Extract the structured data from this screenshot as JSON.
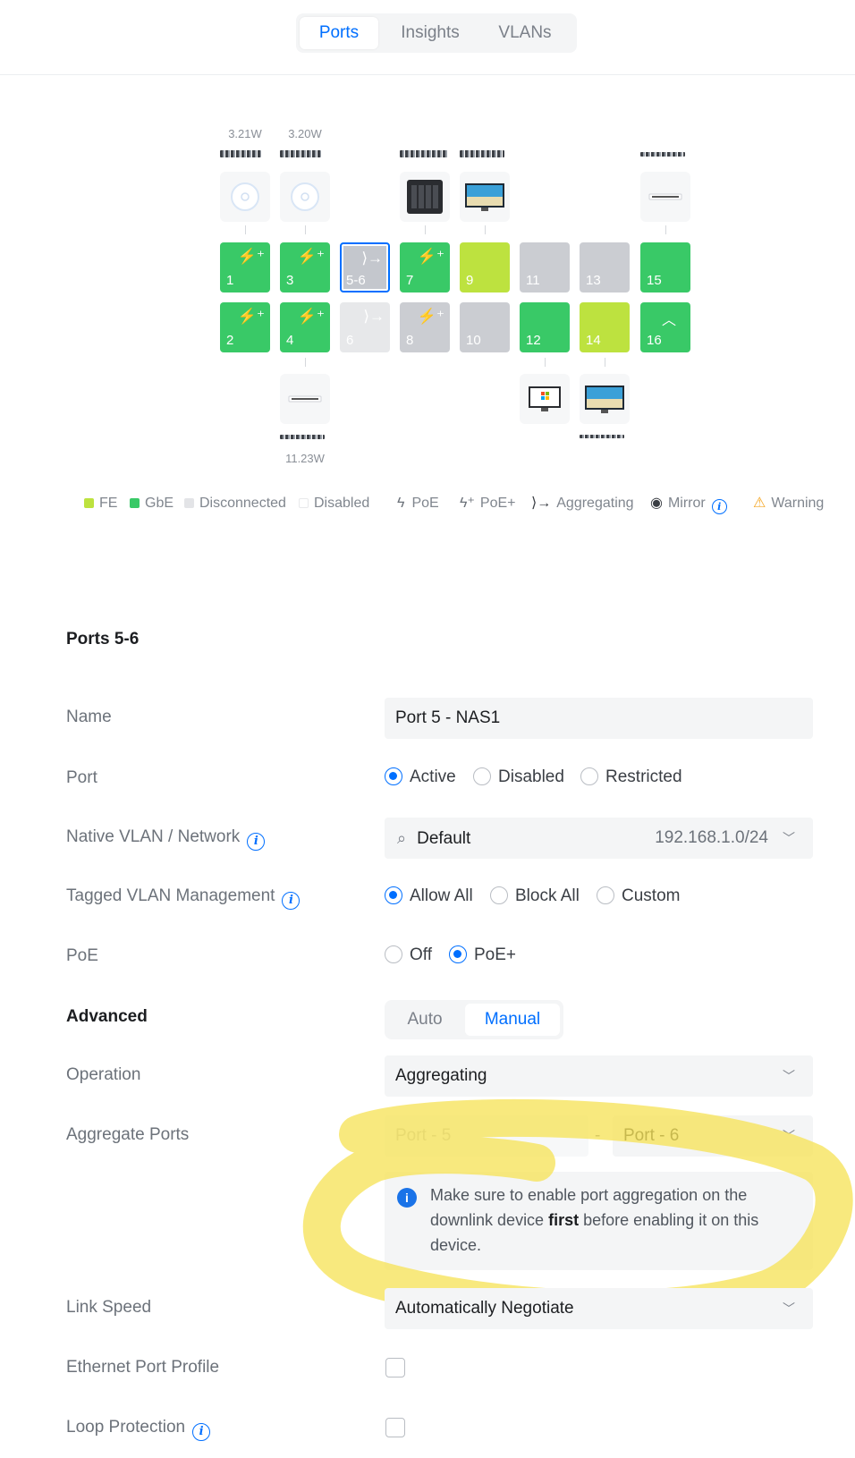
{
  "tabs": [
    "Ports",
    "Insights",
    "VLANs"
  ],
  "active_tab": "Ports",
  "switch": {
    "power_readings": [
      "3.21W",
      "3.20W",
      "11.23W"
    ],
    "ports": [
      {
        "num": "1",
        "state": "GbE",
        "icon": "PoE+"
      },
      {
        "num": "2",
        "state": "GbE",
        "icon": "PoE+"
      },
      {
        "num": "3",
        "state": "GbE",
        "icon": "PoE+"
      },
      {
        "num": "4",
        "state": "GbE",
        "icon": "PoE+"
      },
      {
        "num": "5-6",
        "state": "Disconnected",
        "icon": "Aggregating",
        "selected": true
      },
      {
        "num": "6",
        "state": "Disabled",
        "icon": "Aggregating"
      },
      {
        "num": "7",
        "state": "GbE",
        "icon": "PoE+"
      },
      {
        "num": "8",
        "state": "Disconnected",
        "icon": "PoE+"
      },
      {
        "num": "9",
        "state": "FE",
        "icon": ""
      },
      {
        "num": "10",
        "state": "Disconnected",
        "icon": ""
      },
      {
        "num": "11",
        "state": "Disconnected",
        "icon": ""
      },
      {
        "num": "12",
        "state": "GbE",
        "icon": ""
      },
      {
        "num": "13",
        "state": "Disconnected",
        "icon": ""
      },
      {
        "num": "14",
        "state": "FE",
        "icon": ""
      },
      {
        "num": "15",
        "state": "GbE",
        "icon": ""
      },
      {
        "num": "16",
        "state": "GbE",
        "icon": "uplink"
      }
    ],
    "devices": [
      "access-point-icon",
      "access-point-icon",
      "nas-icon",
      "monitor-icon",
      "switch-icon",
      "switch-icon",
      "windows-pc-icon",
      "monitor-icon"
    ]
  },
  "legend": {
    "fe": "FE",
    "gbe": "GbE",
    "disconnected": "Disconnected",
    "disabled": "Disabled",
    "poe": "PoE",
    "poe_plus": "PoE+",
    "aggregating": "Aggregating",
    "mirror": "Mirror",
    "warning": "Warning"
  },
  "colors": {
    "accent": "#006fff",
    "fe": "#bde23f",
    "gbe": "#39c967",
    "disconnected": "#cbcdd2",
    "disabled": "#e7e8ea",
    "highlight": "#f6e35a"
  },
  "form": {
    "title": "Ports 5-6",
    "name_label": "Name",
    "name_value": "Port 5 - NAS1",
    "port_label": "Port",
    "port_options": [
      "Active",
      "Disabled",
      "Restricted"
    ],
    "port_selected": "Active",
    "native_vlan_label": "Native VLAN / Network",
    "native_vlan_value": "Default",
    "native_vlan_subnet": "192.168.1.0/24",
    "tagged_label": "Tagged VLAN Management",
    "tagged_options": [
      "Allow All",
      "Block All",
      "Custom"
    ],
    "tagged_selected": "Allow All",
    "poe_label": "PoE",
    "poe_options": [
      "Off",
      "PoE+"
    ],
    "poe_selected": "PoE+",
    "advanced_label": "Advanced",
    "advanced_options": [
      "Auto",
      "Manual"
    ],
    "advanced_selected": "Manual",
    "operation_label": "Operation",
    "operation_value": "Aggregating",
    "aggregate_label": "Aggregate Ports",
    "aggregate_from": "Port - 5",
    "aggregate_separator": "-",
    "aggregate_to": "Port - 6",
    "note_before": "Make sure to enable port aggregation on the downlink device ",
    "note_bold": "first",
    "note_after": " before enabling it on this device.",
    "link_speed_label": "Link Speed",
    "link_speed_value": "Automatically Negotiate",
    "eth_profile_label": "Ethernet Port Profile",
    "loop_label": "Loop Protection"
  }
}
